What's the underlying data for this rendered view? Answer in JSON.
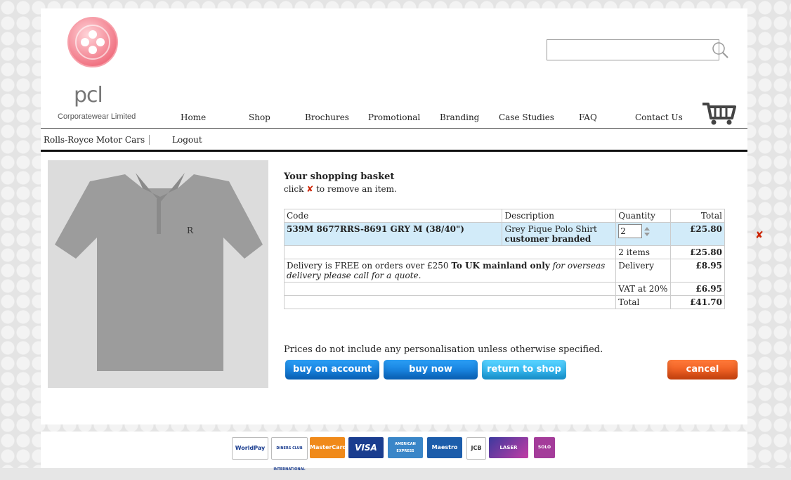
{
  "brand": {
    "name": "pcl",
    "tagline": "Corporatewear Limited"
  },
  "search": {
    "placeholder": ""
  },
  "nav": {
    "items": [
      "Home",
      "Shop",
      "Brochures",
      "Promotional",
      "Branding",
      "Case Studies",
      "FAQ",
      "Contact Us"
    ]
  },
  "subnav": {
    "company": "Rolls-Royce Motor Cars",
    "logout": "Logout"
  },
  "basket": {
    "title": "Your shopping basket",
    "instruction_pre": "click",
    "instruction_post": "to remove an item.",
    "remove_icon": "✘",
    "headers": {
      "code": "Code",
      "description": "Description",
      "quantity": "Quantity",
      "total": "Total"
    },
    "item": {
      "code": "539M 8677RRS-8691 GRY M (38/40\")",
      "desc1": "Grey Pique Polo Shirt",
      "desc2": "customer branded",
      "quantity": "2",
      "total": "£25.80"
    },
    "items_label": "2 items",
    "items_total": "£25.80",
    "delivery_text_a": "Delivery is FREE on orders over £250 ",
    "delivery_text_b": "To UK mainland only",
    "delivery_text_c": " for overseas delivery please call for a quote.",
    "delivery_label": "Delivery",
    "delivery_total": "£8.95",
    "vat_label": "VAT at 20%",
    "vat_total": "£6.95",
    "total_label": "Total",
    "grand_total": "£41.70"
  },
  "notice": "Prices do not include any personalisation unless otherwise specified.",
  "buttons": {
    "account": "buy on account",
    "buy_now": "buy now",
    "return": "return to shop",
    "cancel": "cancel"
  },
  "payments": [
    "WorldPay",
    "DINERS CLUB INTERNATIONAL",
    "MasterCard",
    "VISA",
    "AMERICAN EXPRESS",
    "Maestro",
    "JCB",
    "LASER",
    "SOLO"
  ],
  "colors": {
    "button_blue": "#0a6fd0",
    "button_cyan": "#19a5e8",
    "button_red": "#e24a10",
    "highlight_row": "#d2ebf9",
    "remove_red": "#cc2200"
  }
}
